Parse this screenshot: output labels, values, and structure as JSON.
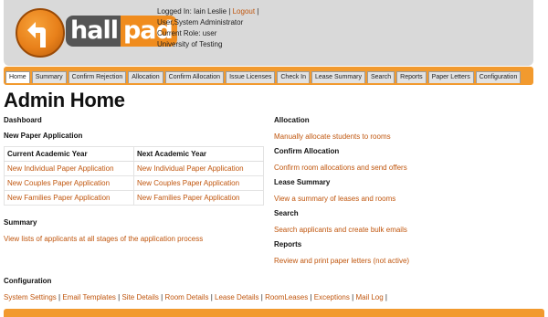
{
  "logo": {
    "part1": "hall",
    "part2": "pad",
    "icon": "turn-left-arrow-icon"
  },
  "user": {
    "logged_in_prefix": "Logged In: Iain Leslie |",
    "logout": "Logout",
    "logout_suffix": "|",
    "name_line": "User,System Administrator",
    "role_line": "Current Role: user",
    "org_line": "University of Testing"
  },
  "tabs": [
    "Home",
    "Summary",
    "Confirm Rejection",
    "Allocation",
    "Confirm Allocation",
    "Issue Licenses",
    "Check In",
    "Lease Summary",
    "Search",
    "Reports",
    "Paper Letters",
    "Configuration"
  ],
  "page_title": "Admin Home",
  "left": {
    "dashboard": "Dashboard",
    "new_paper_application": "New Paper Application",
    "table": {
      "headers": [
        "Current Academic Year",
        "Next Academic Year"
      ],
      "rows": [
        [
          "New Individual Paper Application",
          "New Individual Paper Application"
        ],
        [
          "New Couples Paper Application",
          "New Couples Paper Application"
        ],
        [
          "New Families Paper Application",
          "New Families Paper Application"
        ]
      ]
    },
    "summary_heading": "Summary",
    "summary_link": "View lists of applicants at all stages of the application process"
  },
  "right": {
    "allocation_heading": "Allocation",
    "allocation_link": "Manually allocate students to rooms",
    "confirm_heading": "Confirm Allocation",
    "confirm_link": "Confirm room allocations and send offers",
    "lease_heading": "Lease Summary",
    "lease_link": "View a summary of leases and rooms",
    "search_heading": "Search",
    "search_link": "Search applicants and create bulk emails",
    "reports_heading": "Reports",
    "reports_link": "Review and print paper letters (not active)"
  },
  "configuration": {
    "heading": "Configuration",
    "links": [
      "System Settings",
      "Email Templates",
      "Site Details",
      "Room Details",
      "Lease Details",
      "RoomLeases",
      "Exceptions",
      "Mail Log"
    ],
    "separator": "|"
  },
  "colors": {
    "accent": "#f29a2e",
    "link": "#c0560e",
    "header_bg": "#d9d9d9"
  }
}
